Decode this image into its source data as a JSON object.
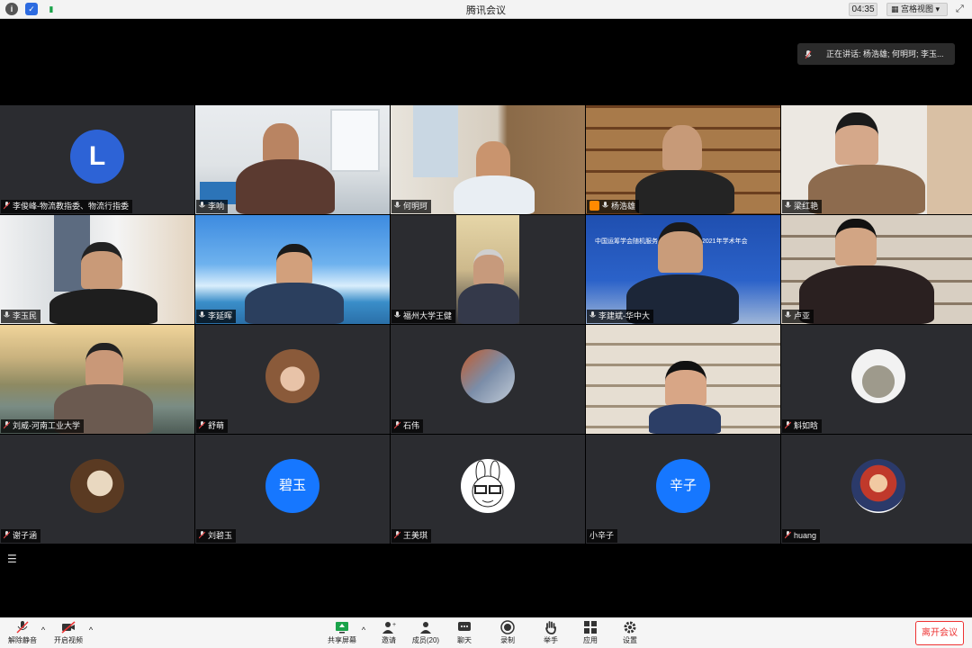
{
  "titlebar": {
    "title": "腾讯会议",
    "timer": "04:35",
    "view_mode": "宫格视图"
  },
  "speaking": {
    "text": "正在讲话: 杨浩雄; 何明珂; 李玉..."
  },
  "participants": [
    {
      "name": "李俊峰-物流教指委、物流行指委",
      "avatar_letter": "L",
      "muted": true
    },
    {
      "name": "李响",
      "muted": false
    },
    {
      "name": "何明珂",
      "muted": false
    },
    {
      "name": "杨浩雄",
      "muted": false,
      "host": true
    },
    {
      "name": "梁红艳",
      "muted": false
    },
    {
      "name": "李玉民",
      "muted": false
    },
    {
      "name": "李延晖",
      "muted": false
    },
    {
      "name": "福州大学王健",
      "muted": false
    },
    {
      "name": "李建斌-华中大",
      "muted": false,
      "banner_text": "中国运筹学会随机服务与运作管理分会2021年学术年会"
    },
    {
      "name": "卢亚",
      "muted": false
    },
    {
      "name": "刘威-河南工业大学",
      "muted": true
    },
    {
      "name": "舒萌",
      "muted": true
    },
    {
      "name": "石伟",
      "muted": true
    },
    {
      "name": "",
      "muted": false
    },
    {
      "name": "斛如晗",
      "muted": true
    },
    {
      "name": "谢子涵",
      "muted": true
    },
    {
      "name": "刘碧玉",
      "avatar_text": "碧玉",
      "muted": true
    },
    {
      "name": "王美琪",
      "muted": true
    },
    {
      "name": "小辛子",
      "avatar_text": "辛子",
      "muted": false
    },
    {
      "name": "huang",
      "muted": true
    }
  ],
  "toolbar": {
    "unmute": "解除静音",
    "start_video": "开启视频",
    "share_screen": "共享屏幕",
    "invite": "邀请",
    "members": "成员(20)",
    "chat": "聊天",
    "record": "录制",
    "raise_hand": "举手",
    "apps": "应用",
    "settings": "设置",
    "leave": "离开会议"
  },
  "colors": {
    "accent": "#1677ff",
    "danger": "#e33333",
    "tile_bg": "#2b2c30"
  }
}
